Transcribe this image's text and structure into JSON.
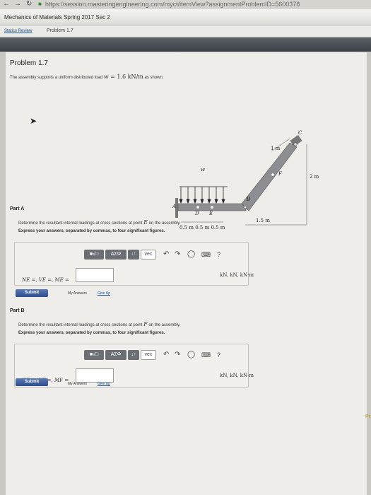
{
  "browser": {
    "url": "https://session.masteringengineering.com/myct/itemView?assignmentProblemID=5600378"
  },
  "header": {
    "course_title": "Mechanics of Materials Spring 2017 Sec 2",
    "breadcrumb_link": "Statics Review",
    "breadcrumb_current": "Problem 1.7"
  },
  "problem": {
    "title": "Problem 1.7",
    "intro_prefix": "The assembly supports a uniform distributed load ",
    "load_symbol": "w",
    "load_value": " = 1.6 kN/m",
    "intro_suffix": " as shown."
  },
  "figure": {
    "labels": {
      "A": "A",
      "B": "B",
      "C": "C",
      "D": "D",
      "E": "E",
      "F": "F",
      "w": "w",
      "dim_1m": "1 m",
      "dim_2m": "2 m",
      "dim_15m": "1.5 m",
      "dim_bottom": "0.5 m   0.5 m   0.5 m"
    }
  },
  "toolbar": {
    "templates_label": "■√□",
    "greek_label": "AΣΦ",
    "arrows_label": "↓↑",
    "vec_label": "vec",
    "undo_icon": "undo-icon",
    "redo_icon": "redo-icon",
    "reset_icon": "reset-icon",
    "keyboard_icon": "keyboard-icon",
    "help_label": "?"
  },
  "partA": {
    "label": "Part A",
    "desc_prefix": "Determine the resultant internal loadings at cross sections at point ",
    "point": "E",
    "desc_suffix": " on the assembly.",
    "instructions": "Express your answers, separated by commas, to four significant figures.",
    "answer_label": "NE =, VE =, ME =",
    "answer_value": "",
    "units": "kN, kN, kN·m",
    "submit_label": "Submit",
    "my_answers_label": "My Answers",
    "give_up_label": "Give Up"
  },
  "partB": {
    "label": "Part B",
    "desc_prefix": "Determine the resultant internal loadings at cross sections at point ",
    "point": "F",
    "desc_suffix": " on the assembly.",
    "instructions": "Express your answers, separated by commas, to four significant figures.",
    "answer_label": "NF =, VF =, MF =",
    "answer_value": "",
    "units": "kN, kN, kN·m",
    "submit_label": "Submit",
    "my_answers_label": "My Answers",
    "give_up_label": "Give Up"
  },
  "side_link": "Pr"
}
